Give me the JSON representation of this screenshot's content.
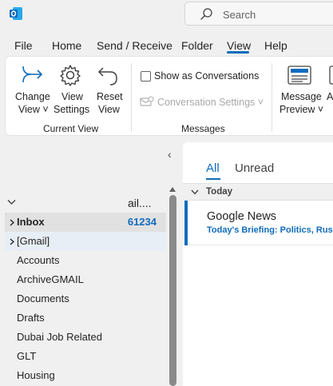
{
  "search": {
    "placeholder": "Search"
  },
  "menu": {
    "tabs": [
      "File",
      "Home",
      "Send / Receive",
      "Folder",
      "View",
      "Help"
    ],
    "active": "View"
  },
  "ribbon": {
    "change_view": [
      "Change",
      "View ˅"
    ],
    "view_settings": [
      "View",
      "Settings"
    ],
    "reset_view": [
      "Reset",
      "View"
    ],
    "show_as_conversations": "Show as Conversations",
    "show_as_conversations_checked": false,
    "conversation_settings": "Conversation Settings ˅",
    "message_preview": [
      "Message",
      "Preview ˅"
    ],
    "partial_next": "A",
    "groups": [
      "Current View",
      "Messages"
    ]
  },
  "folder_pane": {
    "collapse_glyph": "‹",
    "account_name": "ail....",
    "folders": [
      {
        "name": "Inbox",
        "count": "61234",
        "expandable": true,
        "selected": true,
        "bold": true
      },
      {
        "name": "[Gmail]",
        "count": "",
        "expandable": true,
        "selected": false,
        "bold": false
      },
      {
        "name": "Accounts",
        "count": "",
        "expandable": false,
        "selected": false,
        "bold": false
      },
      {
        "name": "ArchiveGMAIL",
        "count": "",
        "expandable": false,
        "selected": false,
        "bold": false
      },
      {
        "name": "Documents",
        "count": "",
        "expandable": false,
        "selected": false,
        "bold": false
      },
      {
        "name": "Drafts",
        "count": "",
        "expandable": false,
        "selected": false,
        "bold": false
      },
      {
        "name": "Dubai Job Related",
        "count": "",
        "expandable": false,
        "selected": false,
        "bold": false
      },
      {
        "name": "GLT",
        "count": "",
        "expandable": false,
        "selected": false,
        "bold": false
      },
      {
        "name": "Housing",
        "count": "",
        "expandable": false,
        "selected": false,
        "bold": false
      }
    ]
  },
  "message_list": {
    "filters": [
      "All",
      "Unread"
    ],
    "active_filter": "All",
    "group_label": "Today",
    "messages": [
      {
        "sender": "Google News",
        "subject": "Today's Briefing: Politics, Russ",
        "unread": true
      }
    ]
  },
  "colors": {
    "accent": "#0f6cbd",
    "outlook_brand": "#0f6cbd"
  }
}
